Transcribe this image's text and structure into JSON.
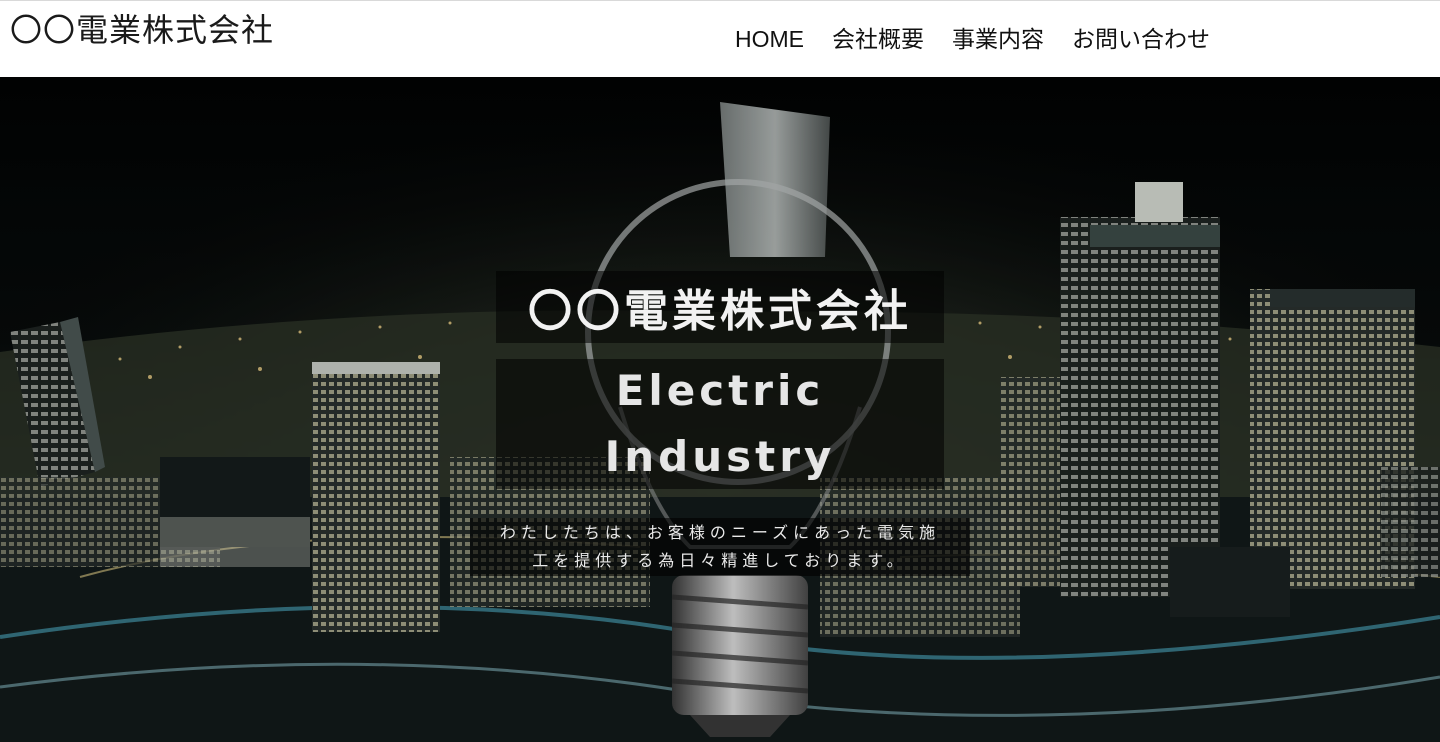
{
  "header": {
    "logo": "〇〇電業株式会社",
    "nav": [
      {
        "label": "HOME"
      },
      {
        "label": "会社概要"
      },
      {
        "label": "事業内容"
      },
      {
        "label": "お問い合わせ"
      }
    ]
  },
  "hero": {
    "title": "〇〇電業株式会社",
    "subtitle_line1": "Electric",
    "subtitle_line2": "Industry",
    "tagline_line1": "わたしたちは、お客様のニーズにあった電気施",
    "tagline_line2": "工を提供する為日々精進しております。",
    "image": "night-city-lightbulb-photo"
  }
}
